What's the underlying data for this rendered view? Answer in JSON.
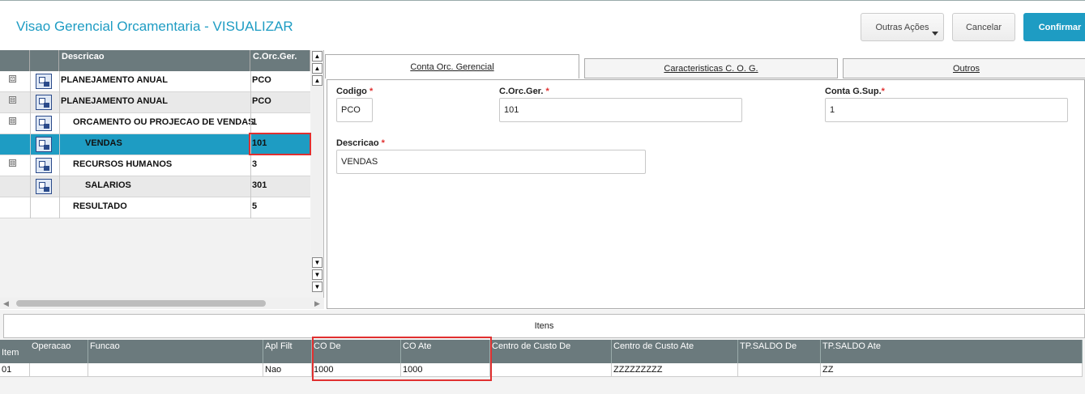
{
  "header": {
    "title": "Visao Gerencial Orcamentaria - VISUALIZAR",
    "buttons": {
      "outras": "Outras Ações",
      "cancel": "Cancelar",
      "confirm": "Confirmar"
    }
  },
  "tree": {
    "columns": {
      "descricao": "Descricao",
      "code": "C.Orc.Ger."
    },
    "rows": [
      {
        "desc": "PLANEJAMENTO ANUAL",
        "code": "PCO",
        "expander": "⊡"
      },
      {
        "desc": "PLANEJAMENTO ANUAL",
        "code": "PCO",
        "expander": "⊟"
      },
      {
        "desc": "ORCAMENTO OU PROJECAO DE VENDAS",
        "code": "1",
        "expander": "⊟"
      },
      {
        "desc": "VENDAS",
        "code": "101",
        "expander": "",
        "selected": true
      },
      {
        "desc": "RECURSOS HUMANOS",
        "code": "3",
        "expander": "⊟"
      },
      {
        "desc": "SALARIOS",
        "code": "301",
        "expander": ""
      },
      {
        "desc": "RESULTADO",
        "code": "5",
        "expander": ""
      }
    ]
  },
  "tabs": [
    "Conta Orc. Gerencial",
    "Caracteristicas C. O. G.",
    "Outros"
  ],
  "form": {
    "codigo": {
      "label": "Codigo",
      "value": "PCO"
    },
    "corcger": {
      "label": "C.Orc.Ger.",
      "value": "101"
    },
    "contagsup": {
      "label": "Conta G.Sup.",
      "value": "1"
    },
    "descricao": {
      "label": "Descricao",
      "value": "VENDAS"
    },
    "required_mark": "*"
  },
  "items": {
    "title": "Itens",
    "columns": [
      "Item",
      "Operacao",
      "Funcao",
      "Apl Filt",
      "CO De",
      "CO Ate",
      "Centro de Custo De",
      "Centro de Custo Ate",
      "TP.SALDO De",
      "TP.SALDO Ate"
    ],
    "row": [
      "01",
      "",
      "",
      "Nao",
      "1000",
      "1000",
      "",
      "ZZZZZZZZZ",
      "",
      "ZZ"
    ]
  },
  "colors": {
    "accent": "#1e9cc3",
    "grid_header": "#6b7a7d",
    "highlight": "#e03030"
  }
}
